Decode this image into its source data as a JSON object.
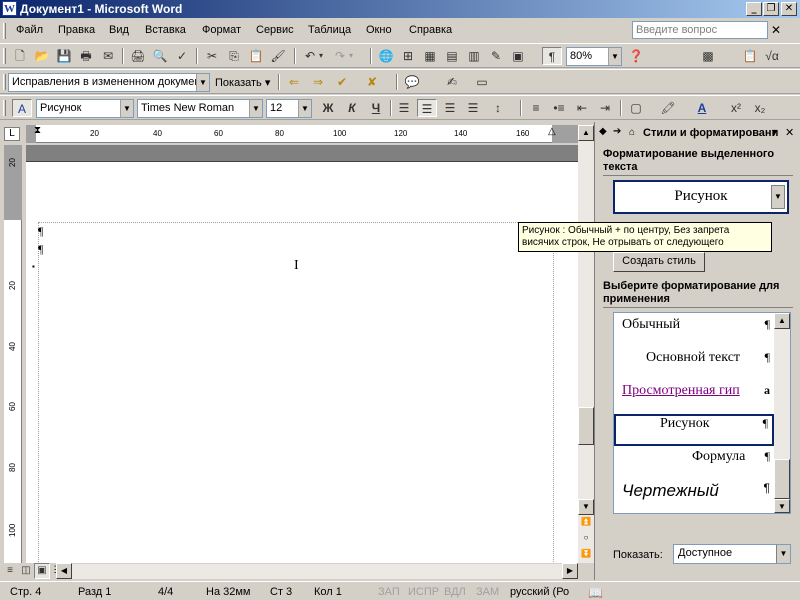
{
  "window": {
    "title": "Документ1 - Microsoft Word",
    "app_icon_letter": "W",
    "min_glyph": "_",
    "max_glyph": "❐",
    "close_glyph": "✕"
  },
  "menu": {
    "items": [
      "Файл",
      "Правка",
      "Вид",
      "Вставка",
      "Формат",
      "Сервис",
      "Таблица",
      "Окно",
      "Справка"
    ],
    "help_placeholder": "Введите вопрос",
    "close_glyph": "✕"
  },
  "toolbar_standard": {
    "zoom": "80%",
    "pilcrow": "¶"
  },
  "toolbar_review": {
    "display_mode": "Исправления в измененном документ",
    "show_label": "Показать ▾"
  },
  "toolbar_formatting": {
    "style": "Рисунок",
    "font": "Times New Roman",
    "size": "12",
    "bold": "Ж",
    "italic": "К",
    "underline": "Ч",
    "superscript": "x²",
    "subscript": "x₂"
  },
  "ruler": {
    "corner_glyph": "L",
    "h_ticks": [
      "20",
      "40",
      "60",
      "80",
      "100",
      "120",
      "140",
      "160"
    ],
    "v_ticks": [
      "20",
      "20",
      "40",
      "60",
      "80",
      "100"
    ]
  },
  "document": {
    "paragraph_mark": "¶",
    "ibeam": "I"
  },
  "tooltip": {
    "text": "Рисунок : Обычный + по центру, Без запрета висячих строк, Не отрывать от следующего"
  },
  "task_pane": {
    "title": "Стили и форматировани",
    "close_glyph": "✕",
    "selected_title": "Форматирование выделенного текста",
    "selected_style": "Рисунок",
    "create_style": "Создать стиль",
    "apply_title": "Выберите форматирование для применения",
    "styles": [
      {
        "name": "Обычный",
        "mark": "¶"
      },
      {
        "name": "Основной текст",
        "mark": "¶"
      },
      {
        "name": "Просмотренная гип",
        "mark": "a"
      },
      {
        "name": "Рисунок",
        "mark": "¶"
      },
      {
        "name": "Формула",
        "mark": "¶"
      },
      {
        "name": "Чертежный",
        "mark": "¶"
      }
    ],
    "show_label": "Показать:",
    "show_value": "Доступное"
  },
  "status": {
    "page": "Стр.  4",
    "section": "Разд  1",
    "pages": "4/4",
    "at": "На 32мм",
    "line": "Ст  3",
    "col": "Кол  1",
    "rec": "ЗАП",
    "trk": "ИСПР",
    "ext": "ВДЛ",
    "ovr": "ЗАМ",
    "language": "русский (Ро"
  }
}
